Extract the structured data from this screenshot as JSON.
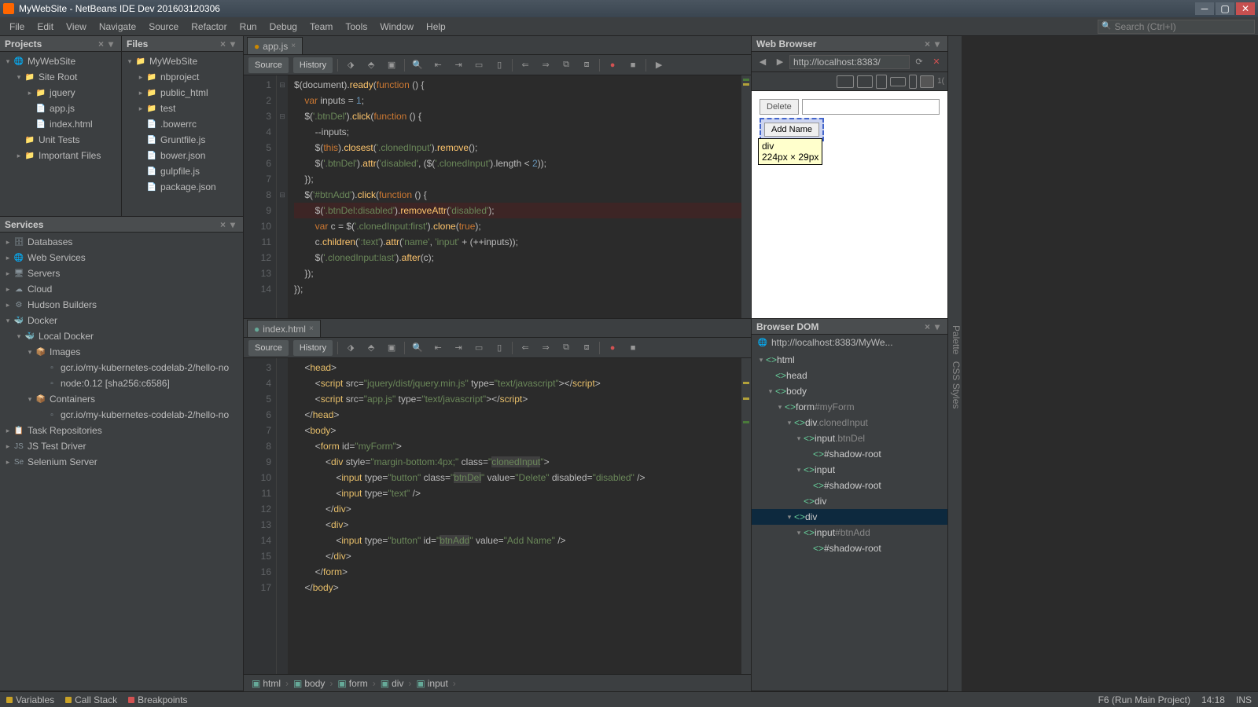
{
  "window": {
    "title": "MyWebSite - NetBeans IDE Dev 201603120306"
  },
  "menubar": {
    "items": [
      "File",
      "Edit",
      "View",
      "Navigate",
      "Source",
      "Refactor",
      "Run",
      "Debug",
      "Team",
      "Tools",
      "Window",
      "Help"
    ],
    "search_placeholder": "Search (Ctrl+I)"
  },
  "panels": {
    "projects": {
      "title": "Projects",
      "tree": [
        {
          "indent": 0,
          "toggle": "▾",
          "icon": "🌐",
          "label": "MyWebSite"
        },
        {
          "indent": 1,
          "toggle": "▾",
          "icon": "📁",
          "label": "Site Root"
        },
        {
          "indent": 2,
          "toggle": "▸",
          "icon": "📁",
          "label": "jquery"
        },
        {
          "indent": 2,
          "toggle": " ",
          "icon": "📄",
          "label": "app.js"
        },
        {
          "indent": 2,
          "toggle": " ",
          "icon": "📄",
          "label": "index.html"
        },
        {
          "indent": 1,
          "toggle": " ",
          "icon": "📁",
          "label": "Unit Tests"
        },
        {
          "indent": 1,
          "toggle": "▸",
          "icon": "📁",
          "label": "Important Files"
        }
      ]
    },
    "files": {
      "title": "Files",
      "tree": [
        {
          "indent": 0,
          "toggle": "▾",
          "icon": "📁",
          "label": "MyWebSite"
        },
        {
          "indent": 1,
          "toggle": "▸",
          "icon": "📁",
          "label": "nbproject"
        },
        {
          "indent": 1,
          "toggle": "▸",
          "icon": "📁",
          "label": "public_html"
        },
        {
          "indent": 1,
          "toggle": "▸",
          "icon": "📁",
          "label": "test"
        },
        {
          "indent": 1,
          "toggle": " ",
          "icon": "📄",
          "label": ".bowerrc"
        },
        {
          "indent": 1,
          "toggle": " ",
          "icon": "📄",
          "label": "Gruntfile.js"
        },
        {
          "indent": 1,
          "toggle": " ",
          "icon": "📄",
          "label": "bower.json"
        },
        {
          "indent": 1,
          "toggle": " ",
          "icon": "📄",
          "label": "gulpfile.js"
        },
        {
          "indent": 1,
          "toggle": " ",
          "icon": "📄",
          "label": "package.json"
        }
      ]
    },
    "services": {
      "title": "Services",
      "tree": [
        {
          "indent": 0,
          "toggle": "▸",
          "icon": "🗄",
          "label": "Databases"
        },
        {
          "indent": 0,
          "toggle": "▸",
          "icon": "🌐",
          "label": "Web Services"
        },
        {
          "indent": 0,
          "toggle": "▸",
          "icon": "🖥",
          "label": "Servers"
        },
        {
          "indent": 0,
          "toggle": "▸",
          "icon": "☁",
          "label": "Cloud"
        },
        {
          "indent": 0,
          "toggle": "▸",
          "icon": "⚙",
          "label": "Hudson Builders"
        },
        {
          "indent": 0,
          "toggle": "▾",
          "icon": "🐳",
          "label": "Docker"
        },
        {
          "indent": 1,
          "toggle": "▾",
          "icon": "🐳",
          "label": "Local Docker"
        },
        {
          "indent": 2,
          "toggle": "▾",
          "icon": "📦",
          "label": "Images"
        },
        {
          "indent": 3,
          "toggle": " ",
          "icon": "▫",
          "label": "gcr.io/my-kubernetes-codelab-2/hello-no"
        },
        {
          "indent": 3,
          "toggle": " ",
          "icon": "▫",
          "label": "node:0.12 [sha256:c6586]"
        },
        {
          "indent": 2,
          "toggle": "▾",
          "icon": "📦",
          "label": "Containers"
        },
        {
          "indent": 3,
          "toggle": " ",
          "icon": "▫",
          "label": "gcr.io/my-kubernetes-codelab-2/hello-no"
        },
        {
          "indent": 0,
          "toggle": "▸",
          "icon": "📋",
          "label": "Task Repositories"
        },
        {
          "indent": 0,
          "toggle": "▸",
          "icon": "JS",
          "label": "JS Test Driver"
        },
        {
          "indent": 0,
          "toggle": "▸",
          "icon": "Se",
          "label": "Selenium Server"
        }
      ]
    },
    "web_browser": {
      "title": "Web Browser",
      "url": "http://localhost:8383/",
      "delete_label": "Delete",
      "add_name_label": "Add Name",
      "tooltip_l1": "div",
      "tooltip_l2": "224px × 29px"
    },
    "browser_dom": {
      "title": "Browser DOM",
      "url": "http://localhost:8383/MyWe...",
      "tree": [
        {
          "indent": 0,
          "toggle": "▾",
          "label": "html",
          "cls": ""
        },
        {
          "indent": 1,
          "toggle": " ",
          "label": "head",
          "cls": ""
        },
        {
          "indent": 1,
          "toggle": "▾",
          "label": "body",
          "cls": ""
        },
        {
          "indent": 2,
          "toggle": "▾",
          "label": "form",
          "cls": "#myForm"
        },
        {
          "indent": 3,
          "toggle": "▾",
          "label": "div",
          "cls": ".clonedInput"
        },
        {
          "indent": 4,
          "toggle": "▾",
          "label": "input",
          "cls": ".btnDel"
        },
        {
          "indent": 5,
          "toggle": " ",
          "label": "#shadow-root",
          "cls": ""
        },
        {
          "indent": 4,
          "toggle": "▾",
          "label": "input",
          "cls": ""
        },
        {
          "indent": 5,
          "toggle": " ",
          "label": "#shadow-root",
          "cls": ""
        },
        {
          "indent": 4,
          "toggle": " ",
          "label": "div",
          "cls": ""
        },
        {
          "indent": 3,
          "toggle": "▾",
          "label": "div",
          "cls": "",
          "selected": true
        },
        {
          "indent": 4,
          "toggle": "▾",
          "label": "input",
          "cls": "#btnAdd"
        },
        {
          "indent": 5,
          "toggle": " ",
          "label": "#shadow-root",
          "cls": ""
        }
      ]
    }
  },
  "editors": {
    "top": {
      "tab_name": "app.js",
      "source_btn": "Source",
      "history_btn": "History",
      "lines": [
        {
          "n": 1,
          "html": "$(document).<span class='fn'>ready</span>(<span class='kw'>function</span> () {"
        },
        {
          "n": 2,
          "html": "    <span class='kw'>var</span> inputs = <span class='num'>1</span>;"
        },
        {
          "n": 3,
          "html": "    $(<span class='str'>'.btnDel'</span>).<span class='fn'>click</span>(<span class='kw'>function</span> () {"
        },
        {
          "n": 4,
          "html": "        --inputs;"
        },
        {
          "n": 5,
          "html": "        $(<span class='kw'>this</span>).<span class='fn'>closest</span>(<span class='str'>'.clonedInput'</span>).<span class='fn'>remove</span>();"
        },
        {
          "n": 6,
          "html": "        $(<span class='str'>'.btnDel'</span>).<span class='fn'>attr</span>(<span class='str'>'disabled'</span>, ($(<span class='str'>'.clonedInput'</span>).length &lt; <span class='num'>2</span>));"
        },
        {
          "n": 7,
          "html": "    });"
        },
        {
          "n": 8,
          "html": "    $(<span class='str'>'#btnAdd'</span>).<span class='fn'>click</span>(<span class='kw'>function</span> () {"
        },
        {
          "n": 9,
          "html": "        $(<span class='str'>'.btnDel:disabled'</span>).<span class='fn'>removeAttr</span>(<span class='str'>'disabled'</span>);",
          "err": true
        },
        {
          "n": 10,
          "html": "        <span class='kw'>var</span> c = $(<span class='str'>'.clonedInput:first'</span>).<span class='fn'>clone</span>(<span class='kw'>true</span>);"
        },
        {
          "n": 11,
          "html": "        c.<span class='fn'>children</span>(<span class='str'>':text'</span>).<span class='fn'>attr</span>(<span class='str'>'name'</span>, <span class='str'>'input'</span> + (++inputs));"
        },
        {
          "n": 12,
          "html": "        $(<span class='str'>'.clonedInput:last'</span>).<span class='fn'>after</span>(c);"
        },
        {
          "n": 13,
          "html": "    });"
        },
        {
          "n": 14,
          "html": "});"
        }
      ]
    },
    "bottom": {
      "tab_name": "index.html",
      "source_btn": "Source",
      "history_btn": "History",
      "lines": [
        {
          "n": 3,
          "html": "    &lt;<span class='tag'>head</span>&gt;"
        },
        {
          "n": 4,
          "html": "        &lt;<span class='tag'>script</span> <span class='attr'>src</span>=<span class='val'>\"jquery/dist/jquery.min.js\"</span> <span class='attr'>type</span>=<span class='val'>\"text/javascript\"</span>&gt;&lt;/<span class='tag'>script</span>&gt;"
        },
        {
          "n": 5,
          "html": "        &lt;<span class='tag'>script</span> <span class='attr'>src</span>=<span class='val'>\"app.js\"</span> <span class='attr'>type</span>=<span class='val'>\"text/javascript\"</span>&gt;&lt;/<span class='tag'>script</span>&gt;"
        },
        {
          "n": 6,
          "html": "    &lt;/<span class='tag'>head</span>&gt;"
        },
        {
          "n": 7,
          "html": "    &lt;<span class='tag'>body</span>&gt;"
        },
        {
          "n": 8,
          "html": "        &lt;<span class='tag'>form</span> <span class='attr'>id</span>=<span class='val'>\"myForm\"</span>&gt;"
        },
        {
          "n": 9,
          "html": "            &lt;<span class='tag'>div</span> <span class='attr'>style</span>=<span class='val'>\"margin-bottom:4px;\"</span> <span class='attr'>class</span>=<span class='val'>\"<span style='background:#404040'>clonedInput</span>\"</span>&gt;"
        },
        {
          "n": 10,
          "html": "                &lt;<span class='tag'>input</span> <span class='attr'>type</span>=<span class='val'>\"button\"</span> <span class='attr'>class</span>=<span class='val'>\"<span style='background:#404040'>btnDel</span>\"</span> <span class='attr'>value</span>=<span class='val'>\"Delete\"</span> <span class='attr'>disabled</span>=<span class='val'>\"disabled\"</span> /&gt;"
        },
        {
          "n": 11,
          "html": "                &lt;<span class='tag'>input</span> <span class='attr'>type</span>=<span class='val'>\"text\"</span> /&gt;"
        },
        {
          "n": 12,
          "html": "            &lt;/<span class='tag'>div</span>&gt;"
        },
        {
          "n": 13,
          "html": "            &lt;<span class='tag'>div</span>&gt;"
        },
        {
          "n": 14,
          "html": "                &lt;<span class='tag'>input</span> <span class='attr'>type</span>=<span class='val'>\"button\"</span> <span class='attr'>id</span>=<span class='val'>\"<span style='background:#404040'>btnAdd</span>\"</span> <span class='attr'>value</span>=<span class='val'>\"Add Name\"</span> /&gt;"
        },
        {
          "n": 15,
          "html": "            &lt;/<span class='tag'>div</span>&gt;"
        },
        {
          "n": 16,
          "html": "        &lt;/<span class='tag'>form</span>&gt;"
        },
        {
          "n": 17,
          "html": "    &lt;/<span class='tag'>body</span>&gt;"
        }
      ],
      "breadcrumb": [
        "html",
        "body",
        "form",
        "div",
        "input"
      ]
    }
  },
  "statusbar": {
    "variables": "Variables",
    "callstack": "Call Stack",
    "breakpoints": "Breakpoints",
    "run_hint": "F6 (Run Main Project)",
    "time": "14:18",
    "ins": "INS"
  },
  "right_strip": {
    "palette": "Palette",
    "css": "CSS Styles"
  }
}
